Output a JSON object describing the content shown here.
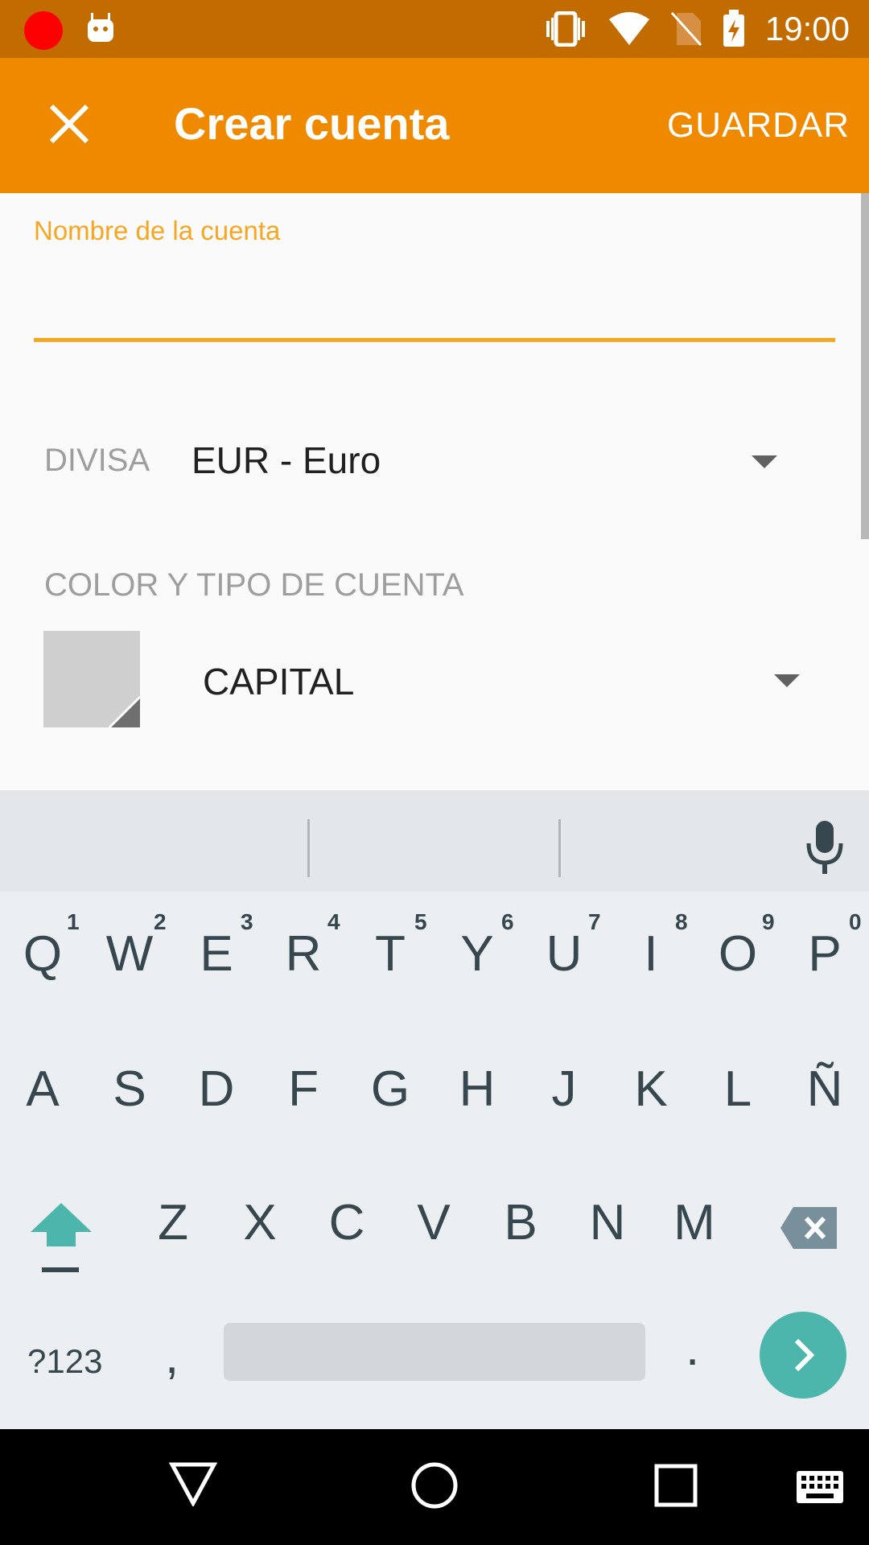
{
  "status": {
    "time": "19:00"
  },
  "appbar": {
    "title": "Crear cuenta",
    "save_label": "GUARDAR"
  },
  "form": {
    "name_label": "Nombre de la cuenta",
    "name_value": "",
    "currency_label": "DIVISA",
    "currency_value": "EUR - Euro",
    "color_type_heading": "COLOR Y TIPO DE CUENTA",
    "account_type_value": "CAPITAL"
  },
  "keyboard": {
    "row1": [
      {
        "k": "Q",
        "n": "1"
      },
      {
        "k": "W",
        "n": "2"
      },
      {
        "k": "E",
        "n": "3"
      },
      {
        "k": "R",
        "n": "4"
      },
      {
        "k": "T",
        "n": "5"
      },
      {
        "k": "Y",
        "n": "6"
      },
      {
        "k": "U",
        "n": "7"
      },
      {
        "k": "I",
        "n": "8"
      },
      {
        "k": "O",
        "n": "9"
      },
      {
        "k": "P",
        "n": "0"
      }
    ],
    "row2": [
      "A",
      "S",
      "D",
      "F",
      "G",
      "H",
      "J",
      "K",
      "L",
      "Ñ"
    ],
    "row3": [
      "Z",
      "X",
      "C",
      "V",
      "B",
      "N",
      "M"
    ],
    "symbols_label": "?123",
    "comma": ",",
    "period": "."
  },
  "colors": {
    "accent": "#ef8a00",
    "statusbar": "#c26c00",
    "field_accent": "#f5a623",
    "enter": "#4db6ac"
  }
}
